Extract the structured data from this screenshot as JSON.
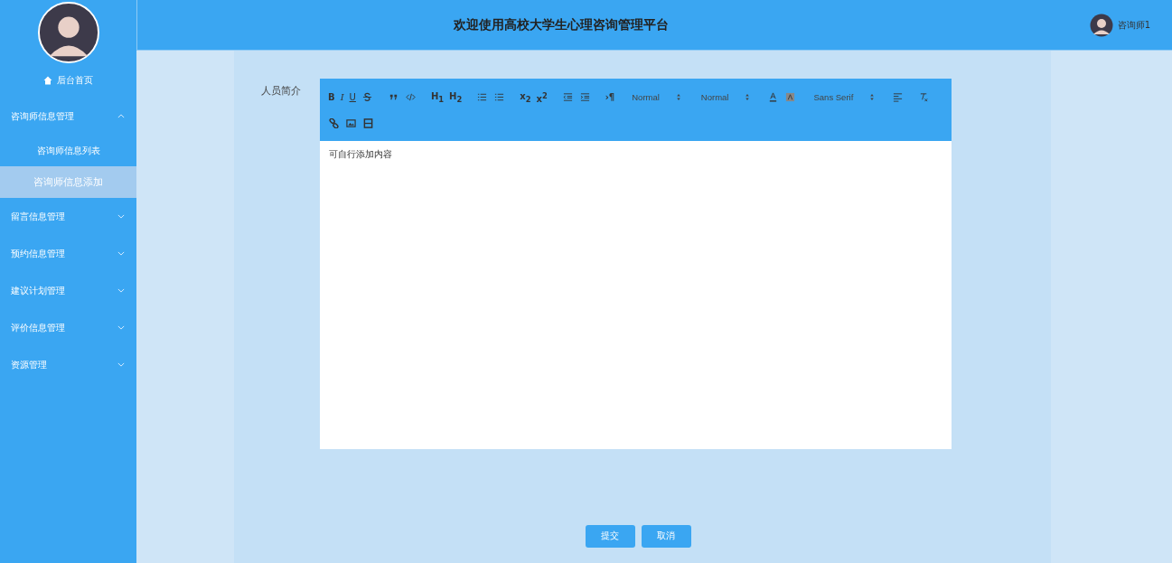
{
  "header": {
    "title": "欢迎使用高校大学生心理咨询管理平台",
    "user": "咨询师1"
  },
  "sidebar": {
    "home": "后台首页",
    "menus": [
      {
        "label": "咨询师信息管理",
        "expanded": true,
        "children": [
          {
            "label": "咨询师信息列表",
            "selected": false
          },
          {
            "label": "咨询师信息添加",
            "selected": true
          }
        ]
      },
      {
        "label": "留言信息管理",
        "expanded": false
      },
      {
        "label": "预约信息管理",
        "expanded": false
      },
      {
        "label": "建议计划管理",
        "expanded": false
      },
      {
        "label": "评价信息管理",
        "expanded": false
      },
      {
        "label": "资源管理",
        "expanded": false
      }
    ]
  },
  "form": {
    "label": "人员简介",
    "content": "可自行添加内容"
  },
  "toolbar": [
    [
      {
        "kind": "text",
        "label": "B"
      },
      {
        "kind": "text",
        "label": "I"
      },
      {
        "kind": "text",
        "label": "U"
      },
      {
        "kind": "strike"
      }
    ],
    [
      {
        "kind": "quote"
      },
      {
        "kind": "code"
      }
    ],
    [
      {
        "kind": "text",
        "label": "H$_{1}$"
      },
      {
        "kind": "text",
        "label": "H$_{2}$"
      }
    ],
    [
      {
        "kind": "ordered"
      },
      {
        "kind": "bullet"
      }
    ],
    [
      {
        "kind": "text",
        "label": "x$_{2}$"
      },
      {
        "kind": "text",
        "label": "x$^{2}$"
      }
    ],
    [
      {
        "kind": "outdent"
      },
      {
        "kind": "indent"
      }
    ],
    [
      {
        "kind": "text",
        "label": "›¶"
      }
    ],
    [
      {
        "kind": "select",
        "label": "Normal"
      }
    ],
    [
      {
        "kind": "select",
        "label": "Normal"
      }
    ],
    [
      {
        "kind": "color"
      },
      {
        "kind": "background"
      }
    ],
    [
      {
        "kind": "select",
        "label": "Sans Serif"
      }
    ],
    [
      {
        "kind": "align"
      }
    ],
    [
      {
        "kind": "clean"
      }
    ],
    [
      {
        "kind": "link"
      },
      {
        "kind": "image"
      },
      {
        "kind": "video"
      }
    ]
  ],
  "buttons": [
    "提交",
    "取消"
  ]
}
